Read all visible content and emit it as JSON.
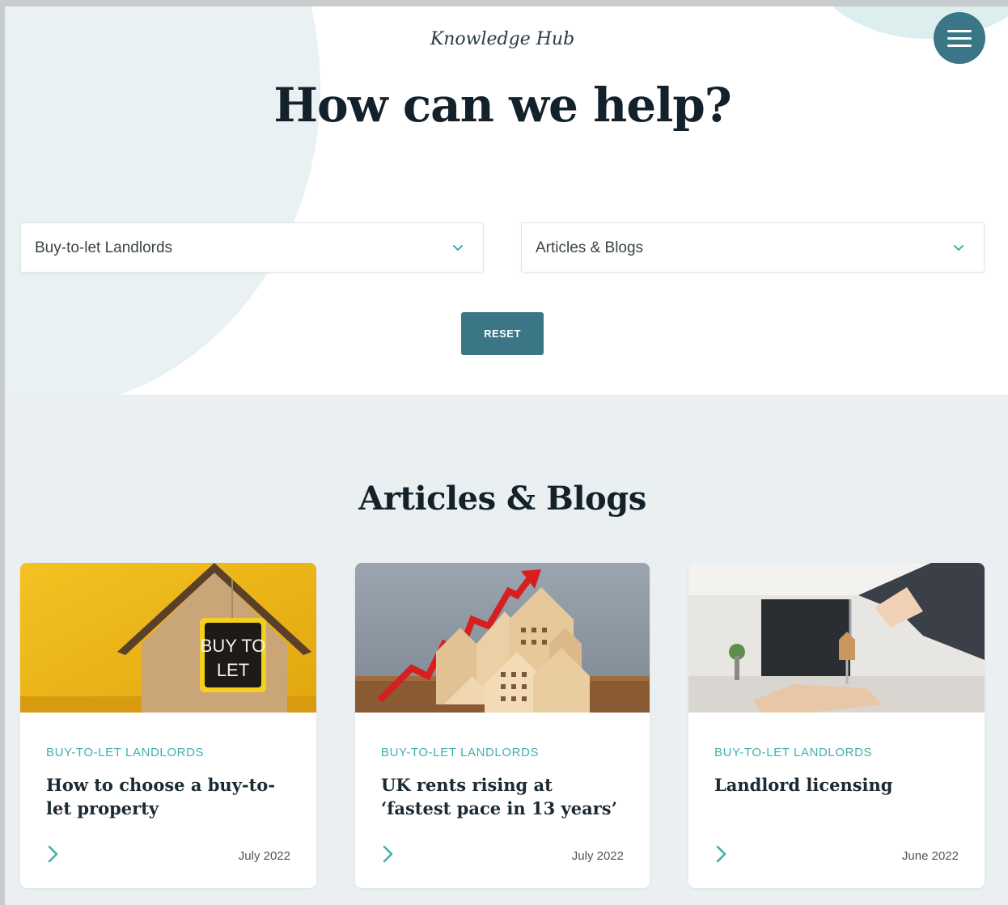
{
  "header": {
    "kicker": "Knowledge Hub",
    "title": "How can we help?",
    "menu_icon": "hamburger-icon"
  },
  "filters": {
    "audience": {
      "selected": "Buy-to-let Landlords"
    },
    "content_type": {
      "selected": "Articles & Blogs"
    },
    "reset_label": "RESET"
  },
  "section": {
    "title": "Articles & Blogs"
  },
  "cards": [
    {
      "category": "BUY-TO-LET LANDLORDS",
      "title": "How to choose a buy-to-let property",
      "date": "July 2022",
      "image_sign_line1": "BUY TO",
      "image_sign_line2": "LET"
    },
    {
      "category": "BUY-TO-LET LANDLORDS",
      "title": "UK rents rising at ‘fastest pace in 13 years’",
      "date": "July 2022"
    },
    {
      "category": "BUY-TO-LET LANDLORDS",
      "title": "Landlord licensing",
      "date": "June 2022"
    }
  ],
  "colors": {
    "primary": "#3a7686",
    "accent": "#3fb0ad",
    "heading": "#13212b",
    "section_bg": "#eaeff1",
    "hero_circle": "#eaf1f2"
  }
}
